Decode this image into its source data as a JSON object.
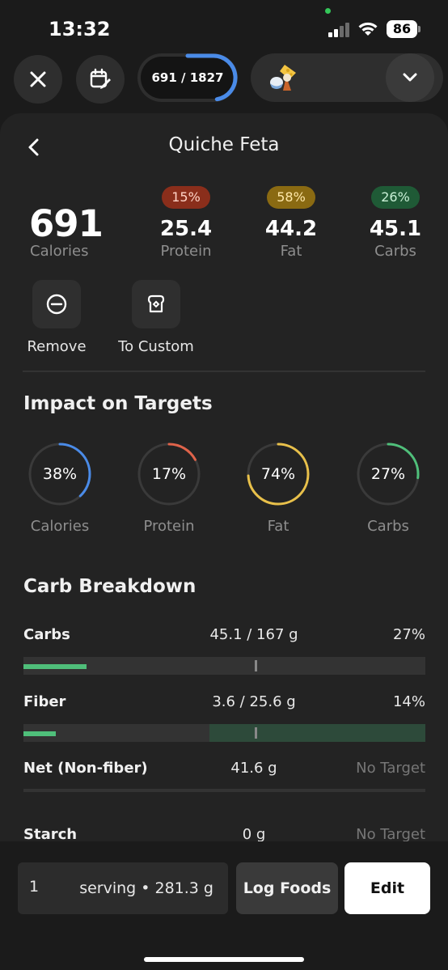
{
  "status_bar": {
    "time": "13:32",
    "battery": "86"
  },
  "toolbar": {
    "calories_progress": "691 / 1827",
    "calories_fraction": 0.378
  },
  "food": {
    "title": "Quiche Feta",
    "calories": {
      "value": "691",
      "label": "Calories"
    },
    "macros": [
      {
        "name": "protein",
        "percent": "15%",
        "value": "25.4",
        "label": "Protein",
        "color": "#8a2e1b"
      },
      {
        "name": "fat",
        "percent": "58%",
        "value": "44.2",
        "label": "Fat",
        "color": "#8a6a12"
      },
      {
        "name": "carbs",
        "percent": "26%",
        "value": "45.1",
        "label": "Carbs",
        "color": "#1f5a36"
      }
    ],
    "actions": {
      "remove": "Remove",
      "to_custom": "To Custom"
    }
  },
  "impact": {
    "heading": "Impact on Targets",
    "rings": [
      {
        "label": "Calories",
        "percent": "38%",
        "fraction": 0.38,
        "color": "#4a8be8"
      },
      {
        "label": "Protein",
        "percent": "17%",
        "fraction": 0.17,
        "color": "#e0634a"
      },
      {
        "label": "Fat",
        "percent": "74%",
        "fraction": 0.74,
        "color": "#e8c04a"
      },
      {
        "label": "Carbs",
        "percent": "27%",
        "fraction": 0.27,
        "color": "#4fbf7a"
      }
    ]
  },
  "carb_breakdown": {
    "heading": "Carb Breakdown",
    "rows": [
      {
        "name": "Carbs",
        "amount": "45.1 / 167 g",
        "percent": "27%",
        "fill_fraction": 0.156
      },
      {
        "name": "Fiber",
        "amount": "3.6 / 25.6 g",
        "percent": "14%",
        "fill_fraction": 0.08
      },
      {
        "name": "Net (Non-fiber)",
        "amount": "41.6 g",
        "percent": "No Target"
      },
      {
        "name": "Starch",
        "amount": "0 g",
        "percent": "No Target"
      }
    ]
  },
  "footer": {
    "quantity": "1",
    "serving": "serving • 281.3 g",
    "log_label": "Log Foods",
    "edit_label": "Edit"
  },
  "colors": {
    "accent_blue": "#4a8be8",
    "carb_green": "#4fbf7a",
    "background": "#1b1b1b"
  }
}
